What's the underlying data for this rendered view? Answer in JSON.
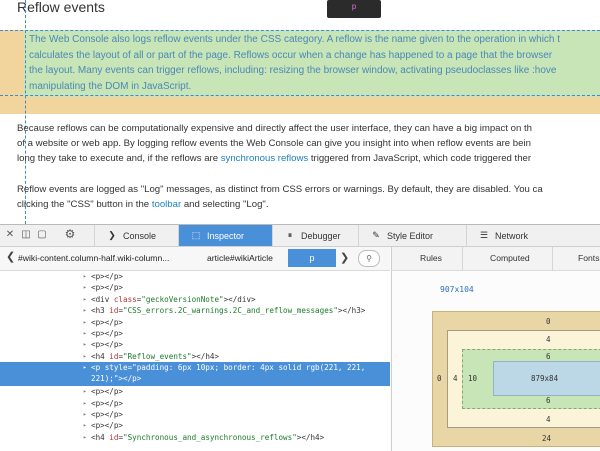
{
  "page": {
    "heading": "Reflow events",
    "tooltip": "p",
    "highlighted_lines": [
      "The Web Console also logs reflow events under the CSS category. A reflow is the name given to the operation in which t",
      "calculates the layout of all or part of the page. Reflows occur when a change has happened to a page that the browser",
      "the layout. Many events can trigger reflows, including: resizing the browser window, activating pseudoclasses like :hove",
      "manipulating the DOM in JavaScript."
    ],
    "para1_line1": "Because reflows can be computationally expensive and directly affect the user interface, they can have a big impact on th",
    "para1_line2": "of a website or web app. By logging reflow events the Web Console can give you insight into when reflow events are bein",
    "para1_line3_a": "long they take to execute and, if the reflows are ",
    "para1_line3_link": "synchronous reflows",
    "para1_line3_b": " triggered from JavaScript, which code triggered ther",
    "para2_line1": "Reflow events are logged as \"Log\" messages, as distinct from CSS errors or warnings. By default, they are disabled. You ca",
    "para2_line2_a": "clicking the \"CSS\" button in the ",
    "para2_line2_link": "toolbar",
    "para2_line2_b": " and selecting \"Log\"."
  },
  "devtools": {
    "tabs": [
      {
        "label": "Console",
        "icon": "console-icon",
        "glyph": "❯",
        "active": false
      },
      {
        "label": "Inspector",
        "icon": "inspector-icon",
        "glyph": "⬚",
        "active": true
      },
      {
        "label": "Debugger",
        "icon": "debugger-icon",
        "glyph": "⏸",
        "active": false
      },
      {
        "label": "Style Editor",
        "icon": "style-editor-icon",
        "glyph": "✎",
        "active": false
      },
      {
        "label": "Network",
        "icon": "network-icon",
        "glyph": "☰",
        "active": false
      }
    ],
    "breadcrumbs": {
      "first": "#wiki-content.column-half.wiki-column...",
      "second": "article#wikiArticle",
      "active": "p"
    },
    "side_tabs": [
      "Rules",
      "Computed",
      "Fonts"
    ],
    "markup": [
      {
        "tag": "<p></p>"
      },
      {
        "tag": "<p></p>"
      },
      {
        "tag": "<div ",
        "attrs": [
          [
            "class",
            "\"geckoVersionNote\""
          ]
        ],
        "end": "></div>"
      },
      {
        "tag": "<h3 ",
        "attrs": [
          [
            "id",
            "\"CSS_errors.2C_warnings.2C_and_reflow_messages\""
          ]
        ],
        "end": "></h3>"
      },
      {
        "tag": "<p></p>"
      },
      {
        "tag": "<p></p>"
      },
      {
        "tag": "<p></p>"
      },
      {
        "tag": "<h4 ",
        "attrs": [
          [
            "id",
            "\"Reflow_events\""
          ]
        ],
        "end": "></h4>"
      },
      {
        "tag": "<p ",
        "attrs": [
          [
            "style",
            "\"padding: 6px 10px; border: 4px solid rgb(221, 221,"
          ]
        ],
        "end": "",
        "selected": true,
        "line2": "221);\"></p>"
      },
      {
        "tag": "<p></p>"
      },
      {
        "tag": "<p></p>"
      },
      {
        "tag": "<p></p>"
      },
      {
        "tag": "<p></p>"
      },
      {
        "tag": "<h4 ",
        "attrs": [
          [
            "id",
            "\"Synchronous_and_asynchronous_reflows\""
          ]
        ],
        "end": "></h4>"
      }
    ],
    "box_model": {
      "dimensions": "907x104",
      "margin_top": "0",
      "border_top": "4",
      "padding_top": "6",
      "content": "879x84",
      "padding_bottom": "6",
      "border_bottom": "4",
      "margin_bottom": "24",
      "margin_left": "0",
      "border_left": "4",
      "padding_left": "10"
    }
  },
  "colors": {
    "accent": "#4a90d9",
    "highlight_margin": "#f1d59c",
    "highlight_padding": "#c8e5b7",
    "link": "#1a7ec4"
  }
}
